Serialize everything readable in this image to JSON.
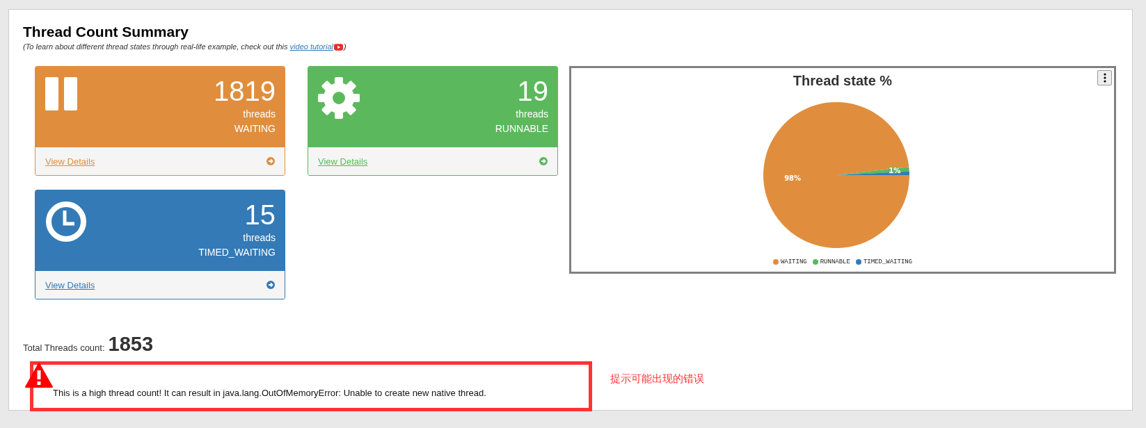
{
  "header": {
    "title": "Thread Count Summary",
    "subtitle_before": "(To learn about different thread states through real-life example, check out this ",
    "subtitle_link": "video tutorial",
    "subtitle_after": ")"
  },
  "cards": [
    {
      "kind": "pause",
      "color": "#e08e3e",
      "count": "1819",
      "unit": "threads",
      "state": "WAITING",
      "link": "View Details"
    },
    {
      "kind": "gear",
      "color": "#5cb85c",
      "count": "19",
      "unit": "threads",
      "state": "RUNNABLE",
      "link": "View Details"
    },
    {
      "kind": "clock",
      "color": "#337ab7",
      "count": "15",
      "unit": "threads",
      "state": "TIMED_WAITING",
      "link": "View Details"
    }
  ],
  "chart": {
    "chart_data": {
      "type": "pie",
      "title": "Thread state %",
      "categories": [
        "WAITING",
        "RUNNABLE",
        "TIMED_WAITING"
      ],
      "values": [
        98.2,
        1.0,
        0.8
      ],
      "colors": [
        "#e08e3e",
        "#5cb85c",
        "#337ab7"
      ],
      "value_labels": [
        "98%",
        "1%",
        null
      ]
    }
  },
  "total": {
    "label": "Total Threads count:",
    "value": "1853"
  },
  "alert": {
    "message": "This is a high thread count! It can result in java.lang.OutOfMemoryError: Unable to create new native thread."
  },
  "annotation": "提示可能出现的错误"
}
